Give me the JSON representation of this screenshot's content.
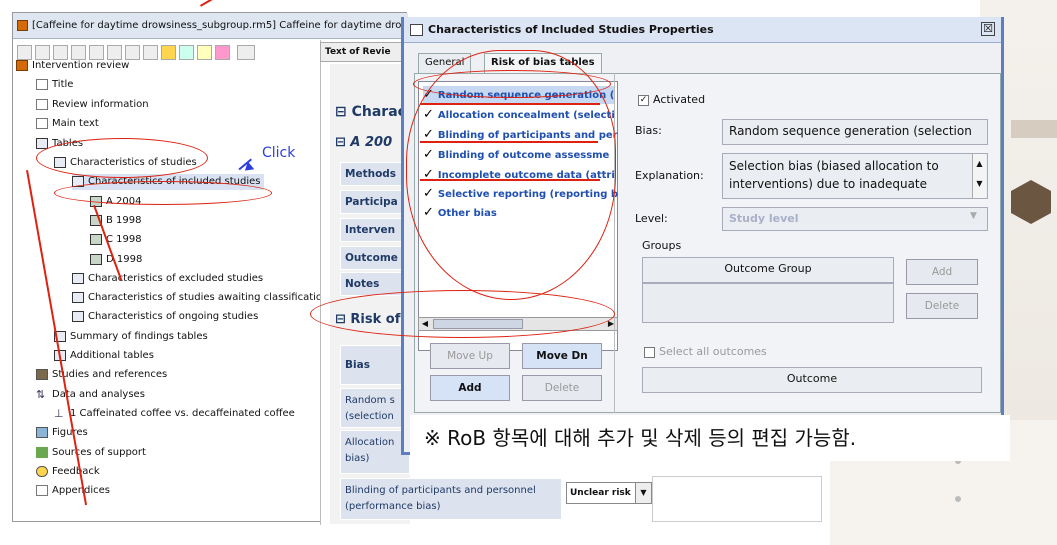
{
  "app": {
    "title": "[Caffeine for daytime drowsiness_subgroup.rm5] Caffeine for daytime dro"
  },
  "tree": {
    "root": "Intervention review",
    "title": "Title",
    "review_info": "Review information",
    "main_text": "Main text",
    "tables": "Tables",
    "char_studies": "Characteristics of studies",
    "char_included": "Characteristics of included studies",
    "studies": [
      "A 2004",
      "B 1998",
      "C 1998",
      "D 1998"
    ],
    "char_excluded": "Characteristics of excluded studies",
    "char_awaiting": "Characteristics of studies awaiting classification",
    "char_ongoing": "Characteristics of ongoing studies",
    "summary": "Summary of findings tables",
    "additional": "Additional tables",
    "studies_refs": "Studies and references",
    "data_analyses": "Data and analyses",
    "comparison": "1 Caffeinated coffee vs. decaffeinated coffee",
    "figures": "Figures",
    "sources": "Sources of support",
    "feedback": "Feedback",
    "appendices": "Appendices"
  },
  "middle": {
    "tab": "Text of Revie",
    "section1": "Charac",
    "section2": "A 200",
    "rows": [
      "Methods",
      "Participa",
      "Interven",
      "Outcome",
      "Notes"
    ],
    "risk_section": "Risk of",
    "bias_header": "Bias",
    "bias_rows": [
      "Random s (selection",
      "Allocation bias)",
      "Blinding of participants and personnel (performance bias)"
    ],
    "risk_value": "Unclear risk"
  },
  "dialog": {
    "title": "Characteristics of Included Studies Properties",
    "close": "☒",
    "tabs": [
      "General",
      "Risk of bias tables"
    ],
    "bias_items": [
      "Random sequence generation (",
      "Allocation concealment (selecti",
      "Blinding of participants and per",
      "Blinding of outcome assessme",
      "Incomplete outcome data (attri",
      "Selective reporting (reporting b",
      "Other bias"
    ],
    "move_up": "Move Up",
    "move_dn": "Move Dn",
    "add": "Add",
    "delete": "Delete",
    "activated": "Activated",
    "bias_label": "Bias:",
    "bias_value": "Random sequence generation (selection",
    "explanation_label": "Explanation:",
    "explanation_value": "Selection bias (biased allocation to\ninterventions) due to inadequate",
    "level_label": "Level:",
    "level_value": "Study level",
    "groups_label": "Groups",
    "outcome_group": "Outcome Group",
    "group_add": "Add",
    "group_delete": "Delete",
    "select_all": "Select all outcomes",
    "outcome": "Outcome"
  },
  "annotation": {
    "click": "Click",
    "note": "※   RoB 항목에 대해 추가 및 삭제 등의 편집 가능함."
  }
}
